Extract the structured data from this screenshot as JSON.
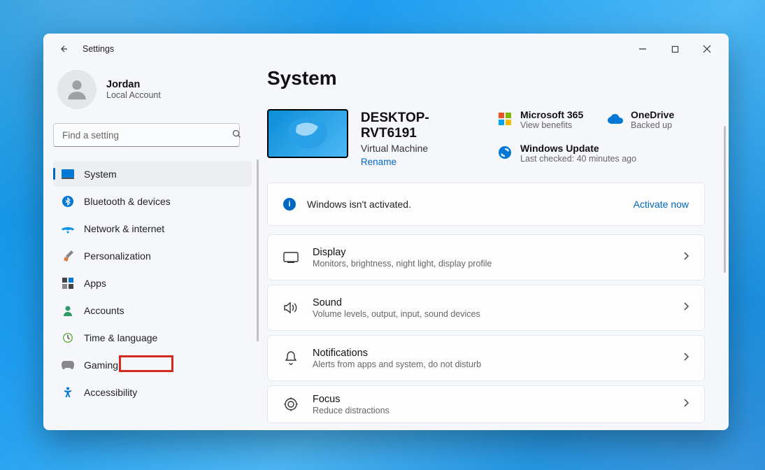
{
  "titlebar": {
    "title": "Settings"
  },
  "profile": {
    "name": "Jordan",
    "subtitle": "Local Account"
  },
  "search": {
    "placeholder": "Find a setting"
  },
  "nav": {
    "items": [
      {
        "label": "System"
      },
      {
        "label": "Bluetooth & devices"
      },
      {
        "label": "Network & internet"
      },
      {
        "label": "Personalization"
      },
      {
        "label": "Apps"
      },
      {
        "label": "Accounts"
      },
      {
        "label": "Time & language"
      },
      {
        "label": "Gaming"
      },
      {
        "label": "Accessibility"
      }
    ]
  },
  "page": {
    "title": "System",
    "pc": {
      "name": "DESKTOP-RVT6191",
      "type": "Virtual Machine",
      "rename": "Rename"
    },
    "promos": {
      "m365": {
        "title": "Microsoft 365",
        "subtitle": "View benefits"
      },
      "onedrive": {
        "title": "OneDrive",
        "subtitle": "Backed up"
      },
      "update": {
        "title": "Windows Update",
        "subtitle": "Last checked: 40 minutes ago"
      }
    },
    "banner": {
      "text": "Windows isn't activated.",
      "action": "Activate now"
    },
    "settings": [
      {
        "title": "Display",
        "subtitle": "Monitors, brightness, night light, display profile"
      },
      {
        "title": "Sound",
        "subtitle": "Volume levels, output, input, sound devices"
      },
      {
        "title": "Notifications",
        "subtitle": "Alerts from apps and system, do not disturb"
      },
      {
        "title": "Focus",
        "subtitle": "Reduce distractions"
      }
    ]
  }
}
